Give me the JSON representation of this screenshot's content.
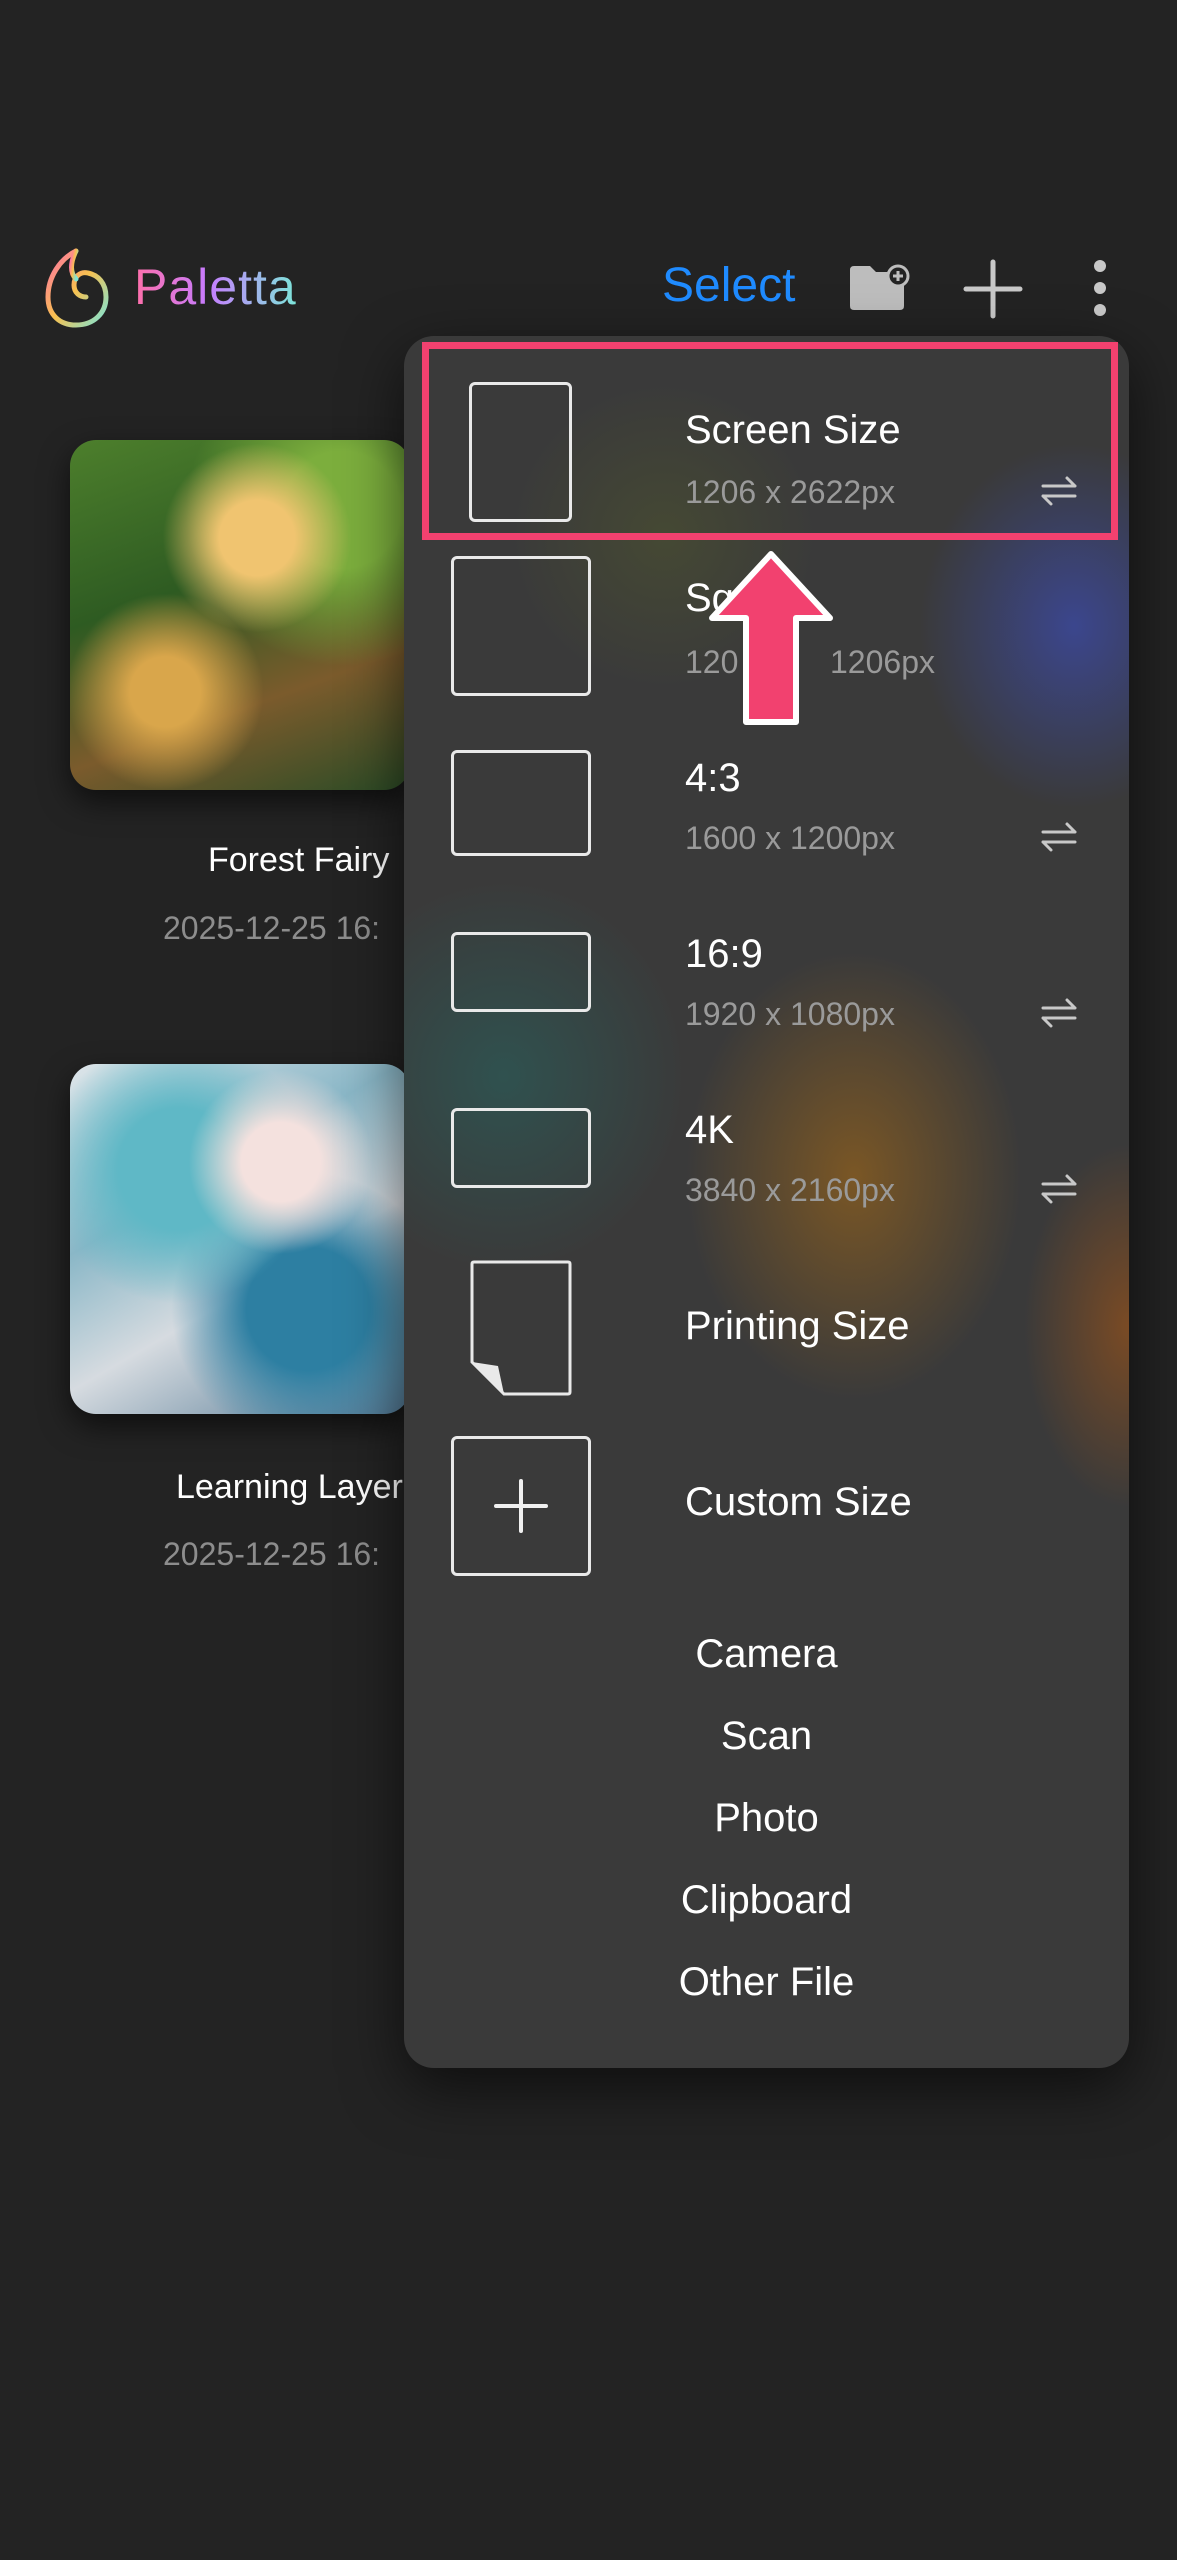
{
  "header": {
    "brand": "Paletta",
    "select_label": "Select",
    "icons": [
      "paletta-logo-icon",
      "new-folder-icon",
      "plus-icon",
      "more-vertical-icon"
    ]
  },
  "gallery": [
    {
      "title": "Forest Fairy",
      "date": "2025-12-25 16:"
    },
    {
      "title": "Learning Layer",
      "date": "2025-12-25 16:"
    }
  ],
  "menu": {
    "sizes": [
      {
        "title": "Screen Size",
        "sub": "1206 x 2622px"
      },
      {
        "title": "Sq",
        "sub": "120",
        "sub2": "1206px"
      },
      {
        "title": "4:3",
        "sub": "1600 x 1200px"
      },
      {
        "title": "16:9",
        "sub": "1920 x 1080px"
      },
      {
        "title": "4K",
        "sub": "3840 x 2160px"
      },
      {
        "title": "Printing Size"
      },
      {
        "title": "Custom Size"
      }
    ],
    "sources": [
      "Camera",
      "Scan",
      "Photo",
      "Clipboard",
      "Other File"
    ]
  },
  "colors": {
    "accent": "#1f8bff",
    "highlight": "#f2416f"
  }
}
